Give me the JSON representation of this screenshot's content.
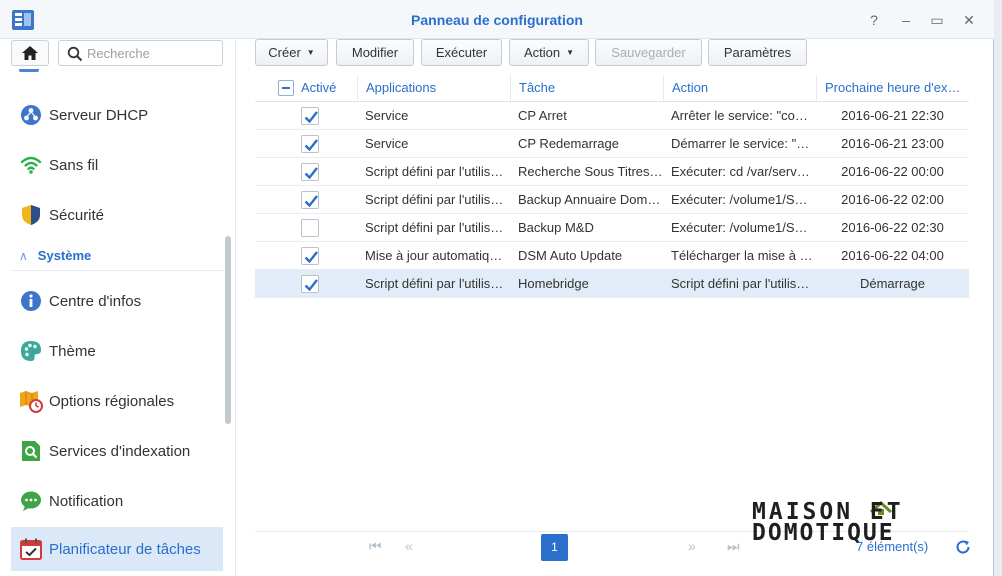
{
  "window": {
    "title": "Panneau de configuration",
    "controls": {
      "help": "?",
      "minimize": "–",
      "maximize": "▭",
      "close": "✕"
    }
  },
  "sidebar": {
    "search_placeholder": "Recherche",
    "items": [
      {
        "id": "dhcp",
        "label": "Serveur DHCP",
        "icon": "dhcp-server-icon"
      },
      {
        "id": "wifi",
        "label": "Sans fil",
        "icon": "wifi-icon"
      },
      {
        "id": "security",
        "label": "Sécurité",
        "icon": "shield-icon"
      }
    ],
    "section": {
      "label": "Système"
    },
    "system_items": [
      {
        "id": "info",
        "label": "Centre d'infos",
        "icon": "info-icon"
      },
      {
        "id": "theme",
        "label": "Thème",
        "icon": "palette-icon"
      },
      {
        "id": "regional",
        "label": "Options régionales",
        "icon": "regional-clock-icon"
      },
      {
        "id": "indexing",
        "label": "Services d'indexation",
        "icon": "index-search-icon"
      },
      {
        "id": "notification",
        "label": "Notification",
        "icon": "chat-bubble-icon"
      },
      {
        "id": "scheduler",
        "label": "Planificateur de tâches",
        "icon": "calendar-check-icon",
        "active": true
      }
    ]
  },
  "toolbar": {
    "create": "Créer",
    "modify": "Modifier",
    "execute": "Exécuter",
    "action": "Action",
    "save": "Sauvegarder",
    "settings": "Paramètres"
  },
  "grid": {
    "columns": [
      "Activé",
      "Applications",
      "Tâche",
      "Action",
      "Prochaine heure d'ex…"
    ],
    "rows": [
      {
        "enabled": true,
        "app": "Service",
        "task": "CP Arret",
        "action": "Arrêter le service: \"co…",
        "next": "2016-06-21 22:30"
      },
      {
        "enabled": true,
        "app": "Service",
        "task": "CP Redemarrage",
        "action": "Démarrer le service: \"…",
        "next": "2016-06-21 23:00"
      },
      {
        "enabled": true,
        "app": "Script défini par l'utilis…",
        "task": "Recherche Sous Titres…",
        "action": "Exécuter: cd /var/serv…",
        "next": "2016-06-22 00:00"
      },
      {
        "enabled": true,
        "app": "Script défini par l'utilis…",
        "task": "Backup Annuaire Dom…",
        "action": "Exécuter: /volume1/S…",
        "next": "2016-06-22 02:00"
      },
      {
        "enabled": false,
        "app": "Script défini par l'utilis…",
        "task": "Backup M&D",
        "action": "Exécuter: /volume1/S…",
        "next": "2016-06-22 02:30"
      },
      {
        "enabled": true,
        "app": "Mise à jour automatiq…",
        "task": "DSM Auto Update",
        "action": "Télécharger la mise à …",
        "next": "2016-06-22 04:00"
      },
      {
        "enabled": true,
        "app": "Script défini par l'utilis…",
        "task": "Homebridge",
        "action": "Script défini par l'utilis…",
        "next": "Démarrage",
        "selected": true
      }
    ]
  },
  "pager": {
    "current_page": "1",
    "count": "7 élément(s)"
  },
  "watermark": {
    "line1": "MAISON ET",
    "line2": "DOMOTIQUE"
  },
  "colors": {
    "accent": "#2a6fcc",
    "selection": "#e2ecf8",
    "active_nav": "#dbe8f7"
  }
}
